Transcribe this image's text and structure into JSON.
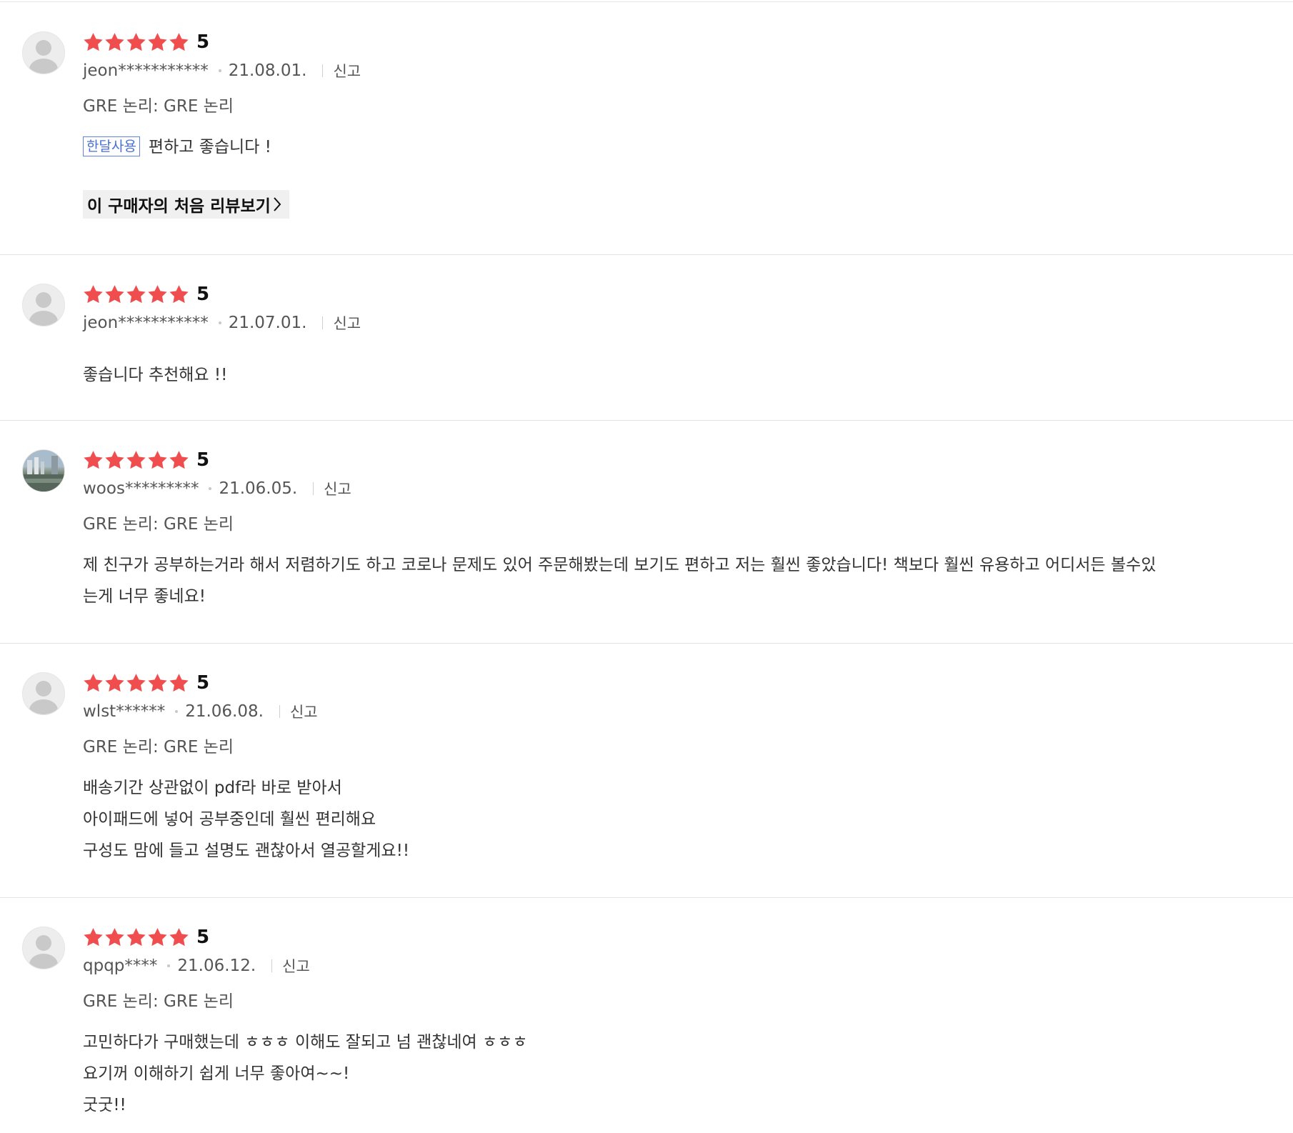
{
  "colors": {
    "star": "#f04e4e",
    "badge_border": "#5f84e6",
    "separator": "#e4e4e4"
  },
  "icons": {
    "avatar": "default-avatar-icon",
    "star": "star-icon",
    "chevron": "chevron-right-icon"
  },
  "reviews": [
    {
      "rating": "5",
      "stars": 5,
      "user": "jeon***********",
      "date": "21.08.01.",
      "report": "신고",
      "option": "GRE 논리: GRE 논리",
      "badge": "한달사용",
      "text": "편하고 좋습니다 !",
      "first_review_button": "이 구매자의 처음 리뷰보기"
    },
    {
      "rating": "5",
      "stars": 5,
      "user": "jeon***********",
      "date": "21.07.01.",
      "report": "신고",
      "text": "좋습니다 추천해요 !!"
    },
    {
      "rating": "5",
      "stars": 5,
      "user": "woos*********",
      "date": "21.06.05.",
      "report": "신고",
      "option": "GRE 논리: GRE 논리",
      "text_lines": [
        "제 친구가 공부하는거라 해서 저렴하기도 하고 코로나 문제도 있어 주문해봤는데 보기도 편하고 저는 훨씬 좋았습니다! 책보다 훨씬 유용하고 어디서든 볼수있",
        "는게 너무 좋네요!"
      ]
    },
    {
      "rating": "5",
      "stars": 5,
      "user": "wlst******",
      "date": "21.06.08.",
      "report": "신고",
      "option": "GRE 논리: GRE 논리",
      "text_lines": [
        "배송기간 상관없이 pdf라 바로 받아서",
        "아이패드에 넣어 공부중인데 훨씬 편리해요",
        "구성도 맘에 들고 설명도 괜찮아서 열공할게요!!"
      ]
    },
    {
      "rating": "5",
      "stars": 5,
      "user": "qpqp****",
      "date": "21.06.12.",
      "report": "신고",
      "option": "GRE 논리: GRE 논리",
      "text_lines": [
        "고민하다가 구매했는데 ㅎㅎㅎ 이해도 잘되고 넘 괜찮네여 ㅎㅎㅎ",
        "요기꺼 이해하기 쉽게 너무 좋아여~~!",
        "굿굿!!"
      ]
    }
  ]
}
